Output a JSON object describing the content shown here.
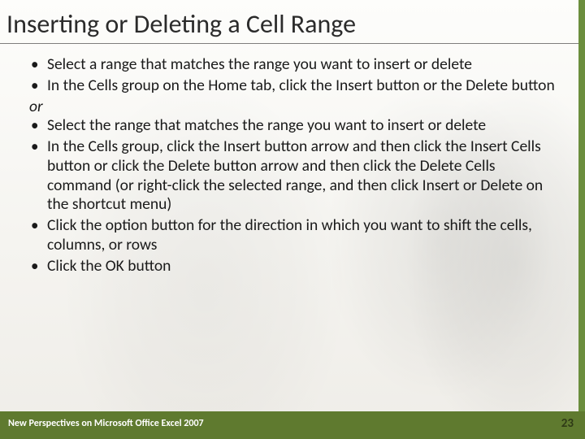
{
  "title": "Inserting or Deleting a Cell Range",
  "bullets": {
    "b1": "Select a range that matches the range you want to insert or delete",
    "b2": "In the Cells group on the Home tab, click the Insert button or the Delete button",
    "or": "or",
    "b3": "Select the range that matches the range you want to insert or delete",
    "b4": "In the Cells group, click the Insert button arrow and then click the Insert Cells button or click the Delete button arrow and then click the Delete Cells command (or right-click the selected range, and then click Insert or Delete on the shortcut menu)",
    "b5": "Click the option button for the direction in which you want to shift the cells, columns, or rows",
    "b6": "Click the OK button"
  },
  "footer": {
    "text": "New Perspectives on Microsoft Office Excel 2007",
    "page": "23"
  }
}
